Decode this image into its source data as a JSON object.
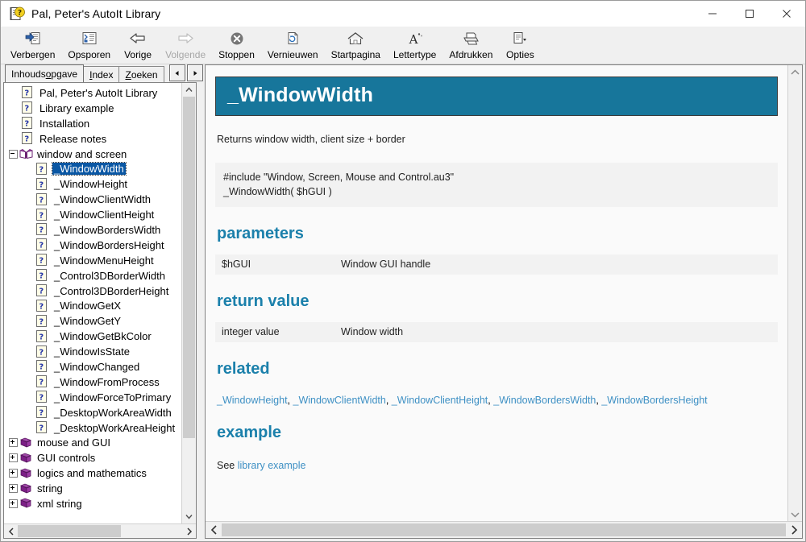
{
  "window": {
    "title": "Pal, Peter's AutoIt Library",
    "icon": "help-document-icon",
    "caption": {
      "minimize": "minimize-icon",
      "maximize": "maximize-icon",
      "close": "close-icon"
    }
  },
  "toolbar": {
    "items": [
      {
        "label": "Verbergen",
        "icon": "hide-pane-icon",
        "disabled": false
      },
      {
        "label": "Opsporen",
        "icon": "locate-icon",
        "disabled": false
      },
      {
        "label": "Vorige",
        "icon": "back-arrow-icon",
        "disabled": false
      },
      {
        "label": "Volgende",
        "icon": "forward-arrow-icon",
        "disabled": true
      },
      {
        "label": "Stoppen",
        "icon": "stop-icon",
        "disabled": false
      },
      {
        "label": "Vernieuwen",
        "icon": "refresh-icon",
        "disabled": false
      },
      {
        "label": "Startpagina",
        "icon": "home-icon",
        "disabled": false
      },
      {
        "label": "Lettertype",
        "icon": "font-icon",
        "disabled": false
      },
      {
        "label": "Afdrukken",
        "icon": "print-icon",
        "disabled": false
      },
      {
        "label": "Opties",
        "icon": "options-icon",
        "disabled": false
      }
    ]
  },
  "tabs": {
    "items": [
      {
        "pre": "Inhouds",
        "accel": "o",
        "post": "pgave",
        "active": true
      },
      {
        "pre": "",
        "accel": "I",
        "post": "ndex",
        "active": false
      },
      {
        "pre": "",
        "accel": "Z",
        "post": "oeken",
        "active": false
      }
    ],
    "spin_left": "spin-left-icon",
    "spin_right": "spin-right-icon"
  },
  "tree": {
    "nodes": [
      {
        "label": "Pal, Peter's AutoIt Library",
        "icon": "page-icon",
        "level": 1,
        "selected": false
      },
      {
        "label": "Library example",
        "icon": "page-icon",
        "level": 1,
        "selected": false
      },
      {
        "label": "Installation",
        "icon": "page-icon",
        "level": 1,
        "selected": false
      },
      {
        "label": "Release notes",
        "icon": "page-icon",
        "level": 1,
        "selected": false
      },
      {
        "label": "window and screen",
        "icon": "book-open-icon",
        "level": 0,
        "expander": "minus",
        "selected": false
      },
      {
        "label": "_WindowWidth",
        "icon": "page-icon",
        "level": 2,
        "selected": true
      },
      {
        "label": "_WindowHeight",
        "icon": "page-icon",
        "level": 2,
        "selected": false
      },
      {
        "label": "_WindowClientWidth",
        "icon": "page-icon",
        "level": 2,
        "selected": false
      },
      {
        "label": "_WindowClientHeight",
        "icon": "page-icon",
        "level": 2,
        "selected": false
      },
      {
        "label": "_WindowBordersWidth",
        "icon": "page-icon",
        "level": 2,
        "selected": false
      },
      {
        "label": "_WindowBordersHeight",
        "icon": "page-icon",
        "level": 2,
        "selected": false
      },
      {
        "label": "_WindowMenuHeight",
        "icon": "page-icon",
        "level": 2,
        "selected": false
      },
      {
        "label": "_Control3DBorderWidth",
        "icon": "page-icon",
        "level": 2,
        "selected": false
      },
      {
        "label": "_Control3DBorderHeight",
        "icon": "page-icon",
        "level": 2,
        "selected": false
      },
      {
        "label": "_WindowGetX",
        "icon": "page-icon",
        "level": 2,
        "selected": false
      },
      {
        "label": "_WindowGetY",
        "icon": "page-icon",
        "level": 2,
        "selected": false
      },
      {
        "label": "_WindowGetBkColor",
        "icon": "page-icon",
        "level": 2,
        "selected": false
      },
      {
        "label": "_WindowIsState",
        "icon": "page-icon",
        "level": 2,
        "selected": false
      },
      {
        "label": "_WindowChanged",
        "icon": "page-icon",
        "level": 2,
        "selected": false
      },
      {
        "label": "_WindowFromProcess",
        "icon": "page-icon",
        "level": 2,
        "selected": false
      },
      {
        "label": "_WindowForceToPrimary",
        "icon": "page-icon",
        "level": 2,
        "selected": false
      },
      {
        "label": "_DesktopWorkAreaWidth",
        "icon": "page-icon",
        "level": 2,
        "selected": false
      },
      {
        "label": "_DesktopWorkAreaHeight",
        "icon": "page-icon",
        "level": 2,
        "selected": false
      },
      {
        "label": "mouse and GUI",
        "icon": "book-closed-icon",
        "level": 0,
        "expander": "plus",
        "selected": false
      },
      {
        "label": "GUI controls",
        "icon": "book-closed-icon",
        "level": 0,
        "expander": "plus",
        "selected": false
      },
      {
        "label": "logics and mathematics",
        "icon": "book-closed-icon",
        "level": 0,
        "expander": "plus",
        "selected": false
      },
      {
        "label": "string",
        "icon": "book-closed-icon",
        "level": 0,
        "expander": "plus",
        "selected": false
      },
      {
        "label": "xml string",
        "icon": "book-closed-icon",
        "level": 0,
        "expander": "plus",
        "selected": false
      }
    ]
  },
  "document": {
    "title": "_WindowWidth",
    "description": "Returns window width, client size + border",
    "code": "#include \"Window, Screen, Mouse and Control.au3\"\n_WindowWidth( $hGUI )",
    "sections": {
      "parameters_heading": "parameters",
      "parameters_rows": [
        {
          "name": "$hGUI",
          "desc": "Window GUI handle"
        }
      ],
      "return_heading": "return value",
      "return_rows": [
        {
          "name": "integer value",
          "desc": "Window width"
        }
      ],
      "related_heading": "related",
      "related_links": [
        "_WindowHeight",
        "_WindowClientWidth",
        "_WindowClientHeight",
        "_WindowBordersWidth",
        "_WindowBordersHeight"
      ],
      "example_heading": "example",
      "example_prefix": "See ",
      "example_link": "library example"
    }
  },
  "colors": {
    "title_banner": "#17769b",
    "heading": "#1b80ab",
    "link": "#3e90c4",
    "selection": "#0a57a4",
    "row_band": "#f2f2f2",
    "page_bg": "#fafafa"
  }
}
